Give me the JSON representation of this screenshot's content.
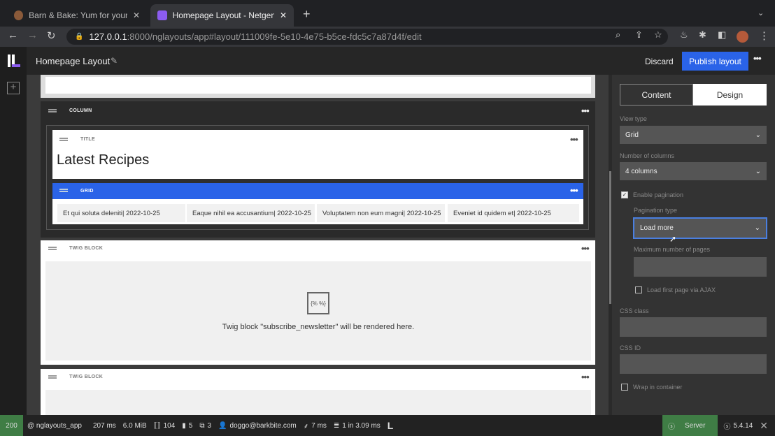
{
  "browser": {
    "tabs": [
      {
        "title": "Barn & Bake: Yum for your Pup"
      },
      {
        "title": "Homepage Layout - Netgen La"
      }
    ],
    "url_host": "127.0.0.1",
    "url_rest": ":8000/nglayouts/app#layout/111009fe-5e10-4e75-b5ce-fdc5c7a87d4f/edit"
  },
  "header": {
    "title": "Homepage Layout",
    "discard": "Discard",
    "publish": "Publish layout"
  },
  "canvas": {
    "column_label": "COLUMN",
    "title_label": "TITLE",
    "title_text": "Latest Recipes",
    "grid_label": "GRID",
    "grid_items": [
      "Et qui soluta deleniti| 2022-10-25",
      "Eaque nihil ea accusantium| 2022-10-25",
      "Voluptatem non eum magni| 2022-10-25",
      "Eveniet id quidem et| 2022-10-25"
    ],
    "twig_label": "TWIG BLOCK",
    "twig_icon_text": "{% %}",
    "twig_text": "Twig block \"subscribe_newsletter\" will be rendered here.",
    "twig_label2": "TWIG BLOCK"
  },
  "panel": {
    "tab_content": "Content",
    "tab_design": "Design",
    "view_type_label": "View type",
    "view_type": "Grid",
    "columns_label": "Number of columns",
    "columns": "4 columns",
    "enable_pagination": "Enable pagination",
    "enable_pagination_checked": true,
    "pagination_type_label": "Pagination type",
    "pagination_type": "Load more",
    "max_pages_label": "Maximum number of pages",
    "max_pages": "",
    "ajax_label": "Load first page via AJAX",
    "ajax_checked": false,
    "css_class_label": "CSS class",
    "css_class": "",
    "css_id_label": "CSS ID",
    "css_id": "",
    "wrap_label": "Wrap in container",
    "wrap_checked": false
  },
  "status": {
    "code": "200",
    "route": "@ nglayouts_app",
    "time": "207 ms",
    "memory": "6.0 MiB",
    "n1": "104",
    "n2": "5",
    "n3": "3",
    "user": "doggo@barkbite.com",
    "t2": "7 ms",
    "db": "1 in 3.09 ms",
    "server": "Server",
    "version": "5.4.14"
  },
  "colors": {
    "accent": "#2a63e8",
    "status_ok": "#3f7d45"
  }
}
